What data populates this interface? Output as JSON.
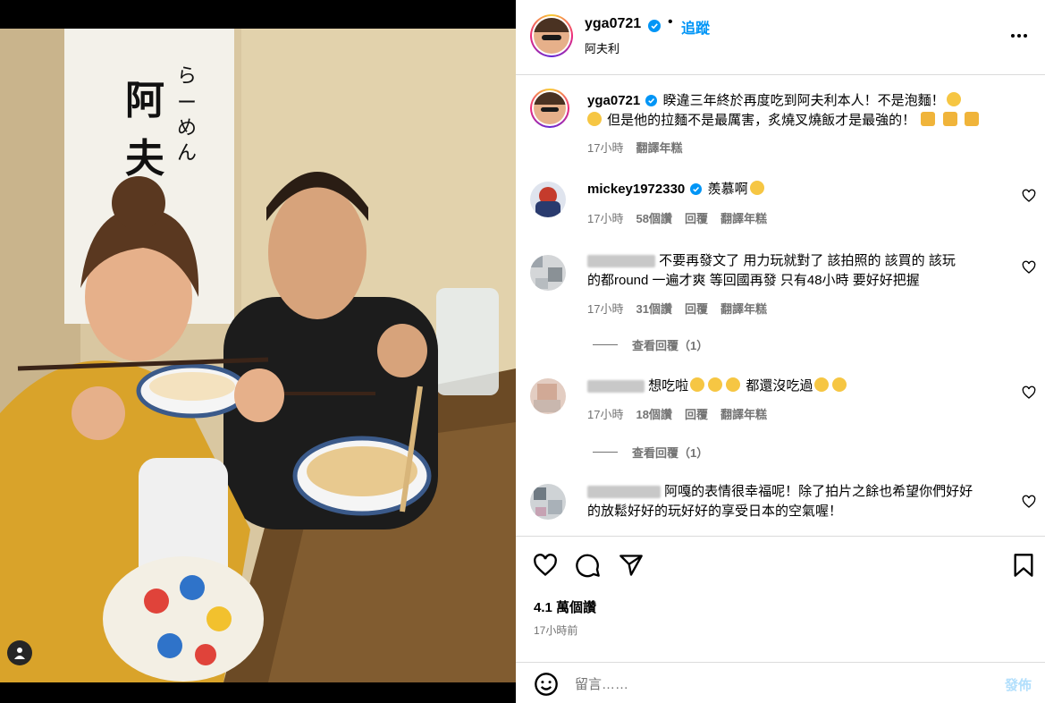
{
  "post": {
    "username": "yga0721",
    "follow_label": "追蹤",
    "dot": "•",
    "location": "阿夫利",
    "caption_line1": "睽違三年終於再度吃到阿夫利本人！不是泡麵！",
    "caption_line2": "但是他的拉麵不是最厲害，炙燒叉燒飯才是最強的！",
    "caption_time": "17小時",
    "caption_translate": "翻譯年糕"
  },
  "comments": [
    {
      "username": "mickey1972330",
      "verified": true,
      "text": "羨慕啊",
      "time": "17小時",
      "likes": "58個讚",
      "reply": "回覆",
      "translate": "翻譯年糕"
    },
    {
      "username": "",
      "text_line1": "不要再發文了 用力玩就對了 該拍照的 該買的 該玩",
      "text_line2": "的都round 一遍才爽 等回國再發 只有48小時 要好好把握",
      "time": "17小時",
      "likes": "31個讚",
      "reply": "回覆",
      "translate": "翻譯年糕",
      "view_replies": "查看回覆（1）"
    },
    {
      "username": "",
      "text_a": "想吃啦",
      "text_b": "都還沒吃過",
      "time": "17小時",
      "likes": "18個讚",
      "reply": "回覆",
      "translate": "翻譯年糕",
      "view_replies": "查看回覆（1）"
    },
    {
      "username": "",
      "text_line1": "阿嘎的表情很幸福呢！除了拍片之餘也希望你們好好",
      "text_line2": "的放鬆好好的玩好好的享受日本的空氣喔！"
    }
  ],
  "actions": {
    "likes": "4.1 萬個讚",
    "time": "17小時前"
  },
  "composer": {
    "placeholder": "留言……",
    "post_label": "發佈"
  },
  "icons": {
    "more": "more-options-icon",
    "like": "heart-icon",
    "comment": "comment-bubble-icon",
    "share": "paper-plane-icon",
    "save": "bookmark-icon",
    "emoji": "smiley-icon",
    "tag": "person-tag-icon",
    "verified": "verified-badge-icon"
  },
  "colors": {
    "link_blue": "#0095f6",
    "post_disabled": "#b2dffc",
    "verified": "#0095f6",
    "muted": "#737373"
  }
}
